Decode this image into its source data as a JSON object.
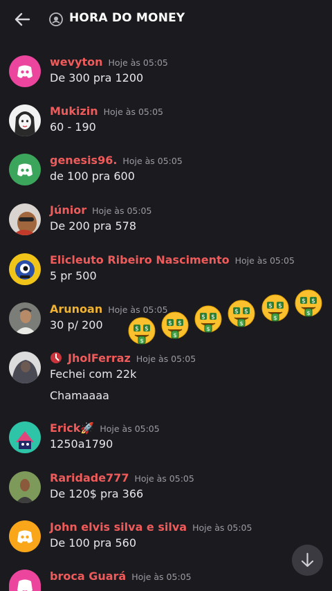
{
  "header": {
    "title": "HORA DO MONEY"
  },
  "colors": {
    "name": "#ef5b5b",
    "arunoan": "#f0b232",
    "discord_pink": "#eb459e",
    "discord_green": "#3ba55c",
    "discord_orange": "#faa61a",
    "bg": "#1b1b1f"
  },
  "messages": [
    {
      "author": "wevyton",
      "time": "Hoje às 05:05",
      "lines": [
        "De 300 pra 1200"
      ]
    },
    {
      "author": "Mukizin",
      "time": "Hoje às 05:05",
      "lines": [
        "60 - 190"
      ]
    },
    {
      "author": "genesis96.",
      "time": "Hoje às 05:05",
      "lines": [
        "de 100 pra 600"
      ]
    },
    {
      "author": "Júnior",
      "time": "Hoje às 05:05",
      "lines": [
        "De 200 pra 578"
      ]
    },
    {
      "author": "Elicleuto Ribeiro Nascimento",
      "time": "Hoje às 05:05",
      "lines": [
        "5 pr 500"
      ]
    },
    {
      "author": "Arunoan",
      "time": "Hoje às 05:05",
      "lines": [
        "30 p/ 200"
      ]
    },
    {
      "author": "JholFerraz",
      "time": "Hoje às 05:05",
      "lines": [
        "Fechei com 22k",
        "Chamaaaa"
      ]
    },
    {
      "author": "Erick🚀",
      "time": "Hoje às 05:05",
      "lines": [
        "1250a1790"
      ]
    },
    {
      "author": "Raridade777",
      "time": "Hoje às 05:05",
      "lines": [
        "De 120$ pra 366"
      ]
    },
    {
      "author": "John elvis silva e silva",
      "time": "Hoje às 05:05",
      "lines": [
        "De 100 pra 560"
      ]
    },
    {
      "author": "broca Guará",
      "time": "Hoje às 05:05",
      "lines": []
    }
  ],
  "icons": [
    "back-arrow-icon",
    "stage-channel-icon",
    "money-mouth-emoji",
    "scroll-down-arrow-icon"
  ]
}
